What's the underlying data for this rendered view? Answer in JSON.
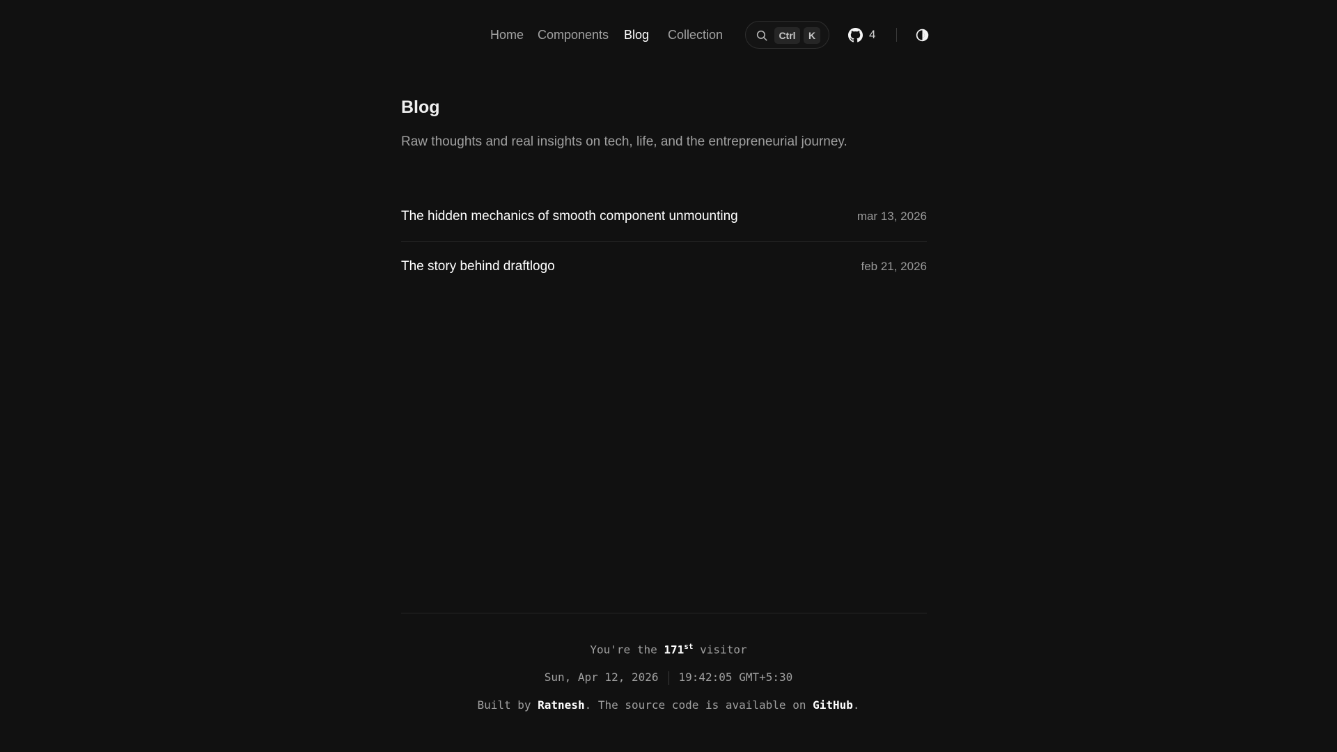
{
  "nav": {
    "links": [
      {
        "label": "Home"
      },
      {
        "label": "Components"
      },
      {
        "label": "Blog"
      },
      {
        "label": "Collection"
      }
    ],
    "active": "Blog",
    "search": {
      "icon": "search-icon",
      "key_ctrl": "Ctrl",
      "key_k": "K"
    },
    "github": {
      "icon": "github-icon",
      "count": "4"
    },
    "theme_toggle": {
      "icon": "theme-toggle-icon"
    }
  },
  "main": {
    "title": "Blog",
    "description": "Raw thoughts and real insights on tech, life, and the entrepreneurial journey.",
    "posts": [
      {
        "title": "The hidden mechanics of smooth component unmounting",
        "date": "mar 13, 2026"
      },
      {
        "title": "The story behind draftlogo",
        "date": "feb 21, 2026"
      }
    ]
  },
  "footer": {
    "visitor_prefix": "You're the",
    "visitor_count": "171",
    "visitor_suffix_ordinal": "st",
    "visitor_suffix": "visitor",
    "date": "Sun, Apr 12, 2026",
    "time": "19:42:05 GMT+5:30",
    "built_prefix": "Built by",
    "author": "Ratnesh",
    "built_middle": ". The source code is available on",
    "source_link": "GitHub",
    "built_suffix": "."
  },
  "colors": {
    "background": "#111111",
    "text_primary": "#ffffff",
    "text_muted": "#a0a0a0",
    "divider": "#262626"
  }
}
